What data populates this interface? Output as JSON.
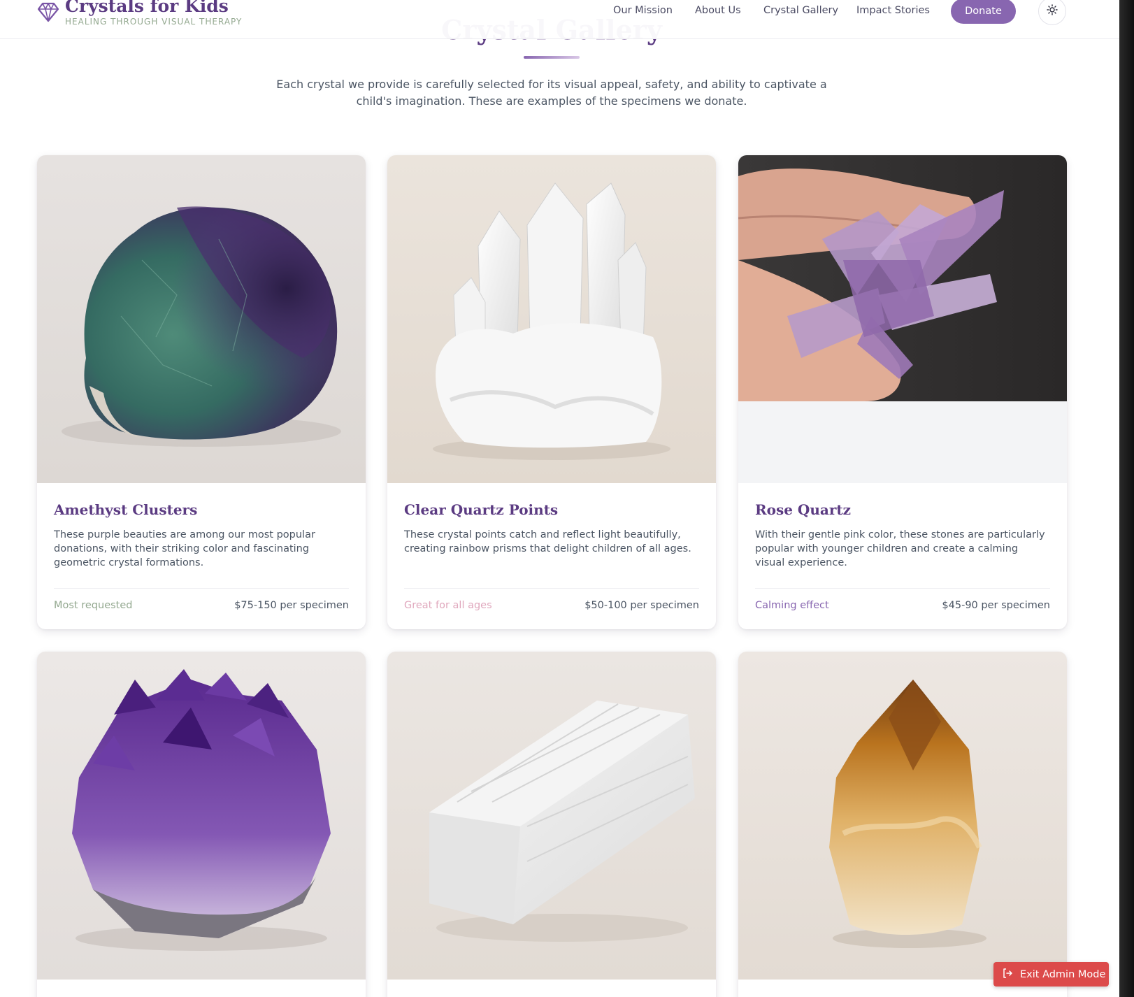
{
  "header": {
    "brand_name": "Crystals for Kids",
    "brand_tagline": "HEALING THROUGH VISUAL THERAPY",
    "nav": [
      "Our Mission",
      "About Us",
      "Crystal Gallery",
      "Impact Stories"
    ],
    "donate_label": "Donate",
    "theme_icon": "sun-icon"
  },
  "section": {
    "title": "Crystal Gallery",
    "description": "Each crystal we provide is carefully selected for its visual appeal, safety, and ability to captivate a child's imagination. These are examples of the specimens we donate."
  },
  "cards": [
    {
      "title": "Amethyst Clusters",
      "description": "These purple beauties are among our most popular donations, with their striking color and fascinating geometric crystal formations.",
      "tag": "Most requested",
      "tag_color": "#93a88f",
      "price": "$75-150 per specimen",
      "image": "green-purple fluorite stone"
    },
    {
      "title": "Clear Quartz Points",
      "description": "These crystal points catch and reflect light beautifully, creating rainbow prisms that delight children of all ages.",
      "tag": "Great for all ages",
      "tag_color": "#e0a8bd",
      "price": "$50-100 per specimen",
      "image": "clear quartz cluster"
    },
    {
      "title": "Rose Quartz",
      "description": "With their gentle pink color, these stones are particularly popular with younger children and create a calming visual experience.",
      "tag": "Calming effect",
      "tag_color": "#8866b0",
      "price": "$45-90 per specimen",
      "image": "pale amethyst crystal cluster held in hand"
    },
    {
      "title": "",
      "image": "amethyst crystal cluster"
    },
    {
      "title": "",
      "image": "white selenite bar"
    },
    {
      "title": "",
      "image": "citrine crystal point"
    }
  ],
  "admin": {
    "exit_label": "Exit Admin Mode",
    "exit_icon": "logout-icon"
  },
  "colors": {
    "brand_purple": "#5b3b82",
    "accent_purple": "#8866b0",
    "sage": "#93a88f",
    "danger": "#dc4a4a"
  }
}
